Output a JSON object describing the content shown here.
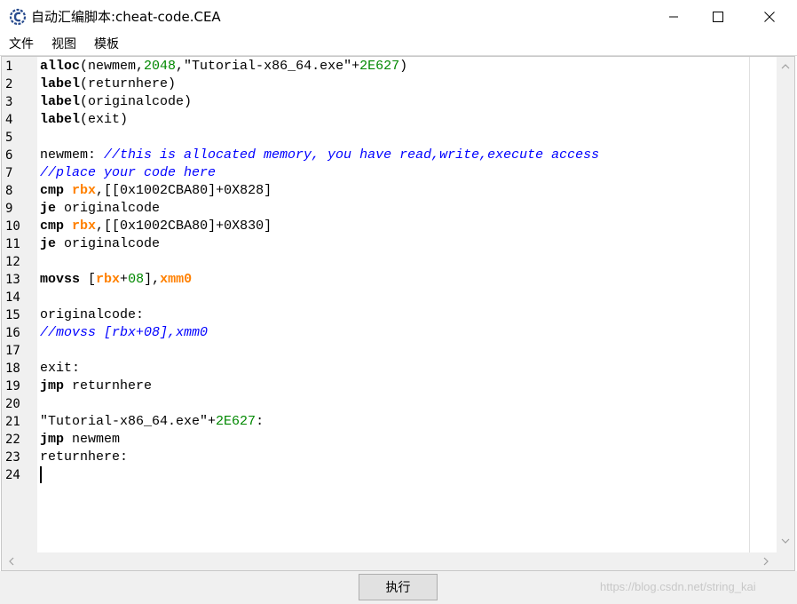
{
  "window": {
    "title": "自动汇编脚本:cheat-code.CEA",
    "controls": {
      "minimize": "minimize-icon",
      "maximize": "maximize-icon",
      "close": "close-icon"
    }
  },
  "menu": [
    "文件",
    "视图",
    "模板"
  ],
  "editor": {
    "line_numbers": [
      "1",
      "2",
      "3",
      "4",
      "5",
      "6",
      "7",
      "8",
      "9",
      "10",
      "11",
      "12",
      "13",
      "14",
      "15",
      "16",
      "17",
      "18",
      "19",
      "20",
      "21",
      "22",
      "23",
      "24"
    ],
    "lines": [
      [
        {
          "t": "alloc",
          "c": "kw"
        },
        {
          "t": "(newmem,"
        },
        {
          "t": "2048",
          "c": "num"
        },
        {
          "t": ",\"Tutorial-x86_64.exe\"+"
        },
        {
          "t": "2E627",
          "c": "num"
        },
        {
          "t": ")"
        }
      ],
      [
        {
          "t": "label",
          "c": "kw"
        },
        {
          "t": "(returnhere)"
        }
      ],
      [
        {
          "t": "label",
          "c": "kw"
        },
        {
          "t": "(originalcode)"
        }
      ],
      [
        {
          "t": "label",
          "c": "kw"
        },
        {
          "t": "(exit)"
        }
      ],
      [],
      [
        {
          "t": "newmem: "
        },
        {
          "t": "//this is allocated memory, you have read,write,execute access",
          "c": "cmt"
        }
      ],
      [
        {
          "t": "//place your code here",
          "c": "cmt"
        }
      ],
      [
        {
          "t": "cmp",
          "c": "kw"
        },
        {
          "t": " "
        },
        {
          "t": "rbx",
          "c": "reg"
        },
        {
          "t": ",[[0x1002CBA80]+0X828]"
        }
      ],
      [
        {
          "t": "je",
          "c": "kw"
        },
        {
          "t": " originalcode"
        }
      ],
      [
        {
          "t": "cmp",
          "c": "kw"
        },
        {
          "t": " "
        },
        {
          "t": "rbx",
          "c": "reg"
        },
        {
          "t": ",[[0x1002CBA80]+0X830]"
        }
      ],
      [
        {
          "t": "je",
          "c": "kw"
        },
        {
          "t": " originalcode"
        }
      ],
      [],
      [
        {
          "t": "movss",
          "c": "kw"
        },
        {
          "t": " ["
        },
        {
          "t": "rbx",
          "c": "reg"
        },
        {
          "t": "+"
        },
        {
          "t": "08",
          "c": "num"
        },
        {
          "t": "],"
        },
        {
          "t": "xmm0",
          "c": "reg"
        }
      ],
      [],
      [
        {
          "t": "originalcode:"
        }
      ],
      [
        {
          "t": "//movss [rbx+08],xmm0",
          "c": "cmt"
        }
      ],
      [],
      [
        {
          "t": "exit:"
        }
      ],
      [
        {
          "t": "jmp",
          "c": "kw"
        },
        {
          "t": " returnhere"
        }
      ],
      [],
      [
        {
          "t": "\"Tutorial-x86_64.exe\"+"
        },
        {
          "t": "2E627",
          "c": "num"
        },
        {
          "t": ":"
        }
      ],
      [
        {
          "t": "jmp",
          "c": "kw"
        },
        {
          "t": " newmem"
        }
      ],
      [
        {
          "t": "returnhere:"
        }
      ],
      []
    ]
  },
  "execute_label": "执行",
  "watermark": "https://blog.csdn.net/string_kai"
}
